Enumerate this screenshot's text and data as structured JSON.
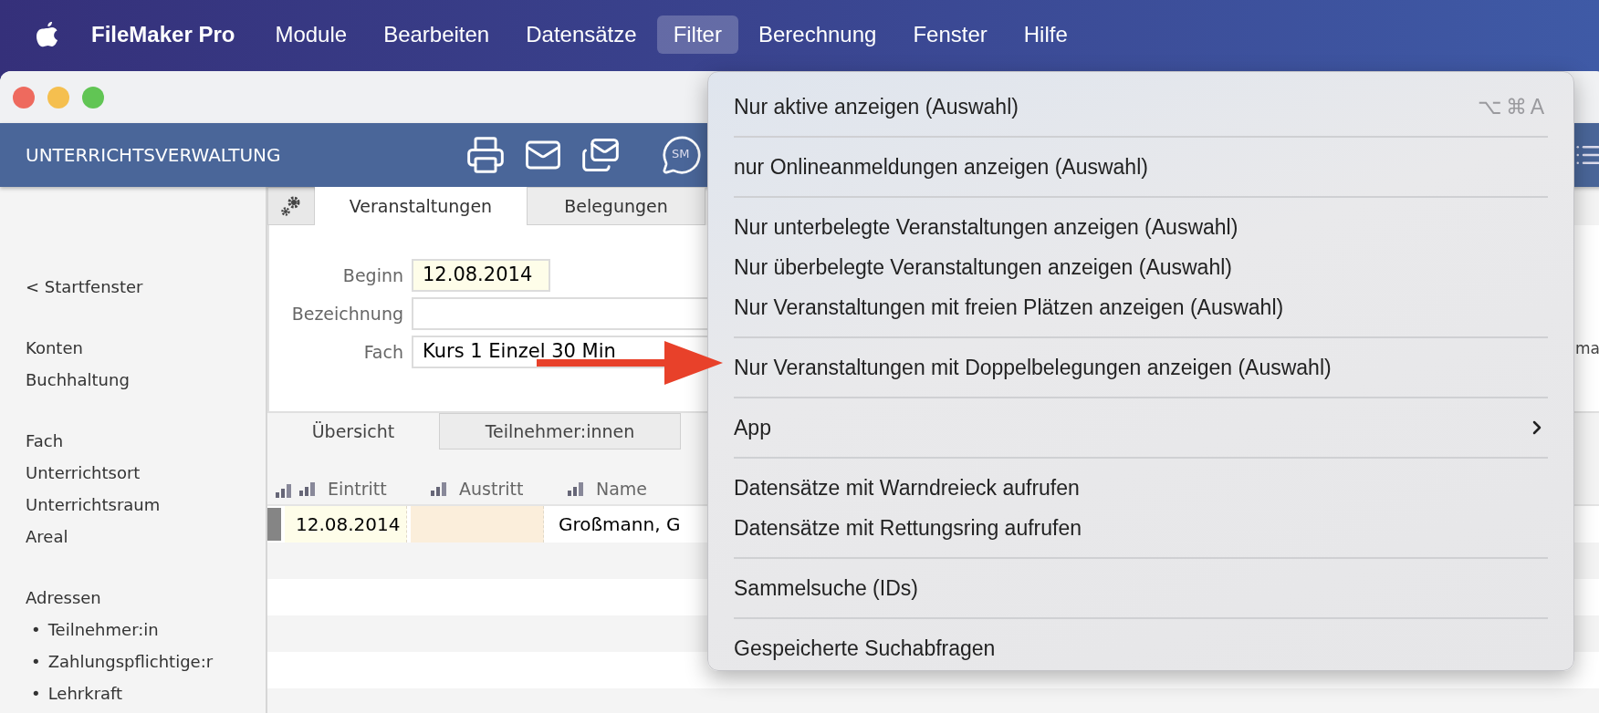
{
  "menubar": {
    "app_name": "FileMaker Pro",
    "items": [
      {
        "label": "Module",
        "selected": false
      },
      {
        "label": "Bearbeiten",
        "selected": false
      },
      {
        "label": "Datensätze",
        "selected": false
      },
      {
        "label": "Filter",
        "selected": true
      },
      {
        "label": "Berechnung",
        "selected": false
      },
      {
        "label": "Fenster",
        "selected": false
      },
      {
        "label": "Hilfe",
        "selected": false
      }
    ]
  },
  "header": {
    "title": "UNTERRICHTSVERWALTUNG",
    "sms_label": "SM"
  },
  "sidebar": {
    "groups": [
      [
        {
          "label": "< Startfenster",
          "kind": "link"
        }
      ],
      [
        {
          "label": "Konten",
          "kind": "link"
        },
        {
          "label": "Buchhaltung",
          "kind": "link"
        }
      ],
      [
        {
          "label": "Fach",
          "kind": "link"
        },
        {
          "label": "Unterrichtsort",
          "kind": "link"
        },
        {
          "label": "Unterrichtsraum",
          "kind": "link"
        },
        {
          "label": "Areal",
          "kind": "link"
        }
      ],
      [
        {
          "label": "Adressen",
          "kind": "link"
        },
        {
          "label": "Teilnehmer:in",
          "kind": "sub",
          "bullet": "•"
        },
        {
          "label": "Zahlungspflichtige:r",
          "kind": "sub",
          "bullet": "•"
        },
        {
          "label": "Lehrkraft",
          "kind": "sub",
          "bullet": "•"
        }
      ]
    ]
  },
  "tabs": [
    {
      "label": "Veranstaltungen",
      "selected": true
    },
    {
      "label": "Belegungen",
      "selected": false
    }
  ],
  "form": {
    "fields": [
      {
        "label": "Beginn",
        "value": "12.08.2014",
        "kind": "short"
      },
      {
        "label": "Bezeichnung",
        "kind": "wide"
      },
      {
        "label": "Fach",
        "value": "Kurs 1 Einzel 30 Min",
        "kind": "wide"
      }
    ],
    "right_fragment": "ma"
  },
  "subtabs": [
    {
      "label": "Übersicht",
      "selected": true
    },
    {
      "label": "Teilnehmer:innen",
      "selected": false
    }
  ],
  "table": {
    "columns": [
      "Eintritt",
      "Austritt",
      "Name"
    ],
    "rows": [
      {
        "cells": [
          "12.08.2014",
          "",
          "Großmann, G"
        ]
      }
    ]
  },
  "menu": {
    "groups": [
      [
        {
          "label": "Nur aktive anzeigen (Auswahl)",
          "kind": "item",
          "shortcut": "⌥⌘A"
        }
      ],
      [
        {
          "label": "nur Onlineanmeldungen anzeigen (Auswahl)",
          "kind": "item"
        }
      ],
      [
        {
          "label": "Nur unterbelegte Veranstaltungen anzeigen (Auswahl)",
          "kind": "item"
        },
        {
          "label": "Nur überbelegte Veranstaltungen anzeigen (Auswahl)",
          "kind": "item"
        },
        {
          "label": "Nur Veranstaltungen mit freien Plätzen anzeigen (Auswahl)",
          "kind": "item"
        }
      ],
      [
        {
          "label": "Nur Veranstaltungen mit Doppelbelegungen anzeigen (Auswahl)",
          "kind": "item"
        }
      ],
      [
        {
          "label": "App",
          "kind": "submenu"
        }
      ],
      [
        {
          "label": "Datensätze mit Warndreieck aufrufen",
          "kind": "item"
        },
        {
          "label": "Datensätze mit Rettungsring aufrufen",
          "kind": "item"
        }
      ],
      [
        {
          "label": "Sammelsuche (IDs)",
          "kind": "item"
        }
      ],
      [
        {
          "label": "Gespeicherte Suchabfragen",
          "kind": "item"
        }
      ]
    ]
  }
}
